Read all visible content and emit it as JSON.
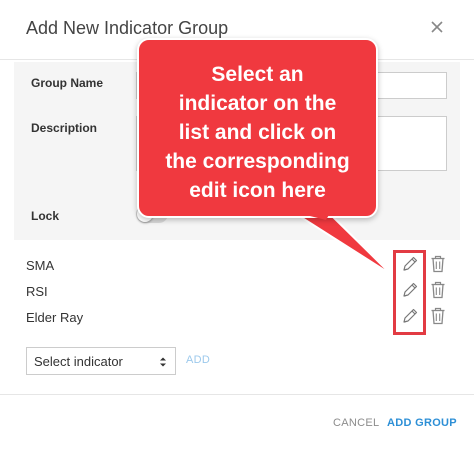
{
  "dialog": {
    "title": "Add New Indicator Group",
    "close_icon": "close-icon"
  },
  "form": {
    "group_name_label": "Group Name",
    "group_name_value": "",
    "description_label": "Description",
    "description_value": "",
    "lock_label": "Lock",
    "lock_on": false
  },
  "indicators": [
    {
      "name": "SMA",
      "edit_icon": "pencil-icon",
      "delete_icon": "trash-icon"
    },
    {
      "name": "RSI",
      "edit_icon": "pencil-icon",
      "delete_icon": "trash-icon"
    },
    {
      "name": "Elder Ray",
      "edit_icon": "pencil-icon",
      "delete_icon": "trash-icon"
    }
  ],
  "add_row": {
    "select_value": "Select indicator",
    "add_label": "ADD"
  },
  "footer": {
    "cancel_label": "CANCEL",
    "add_group_label": "ADD GROUP"
  },
  "callout": {
    "text": "Select an\nindicator on the\nlist and click on\nthe corresponding\nedit icon here"
  },
  "colors": {
    "accent": "#2d8fd6",
    "callout_red": "#f0393f",
    "highlight_red": "#e23b43",
    "disabled_link": "#9cc9ec"
  }
}
